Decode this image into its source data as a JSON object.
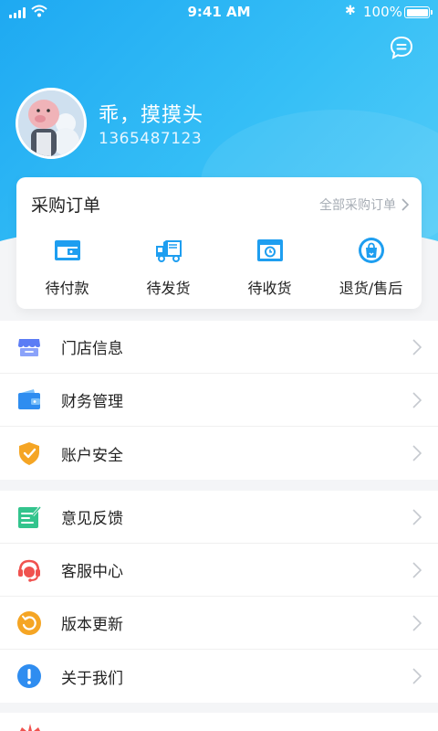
{
  "status_bar": {
    "time": "9:41 AM",
    "battery": "100%",
    "battery_level": 1.0
  },
  "header": {
    "message_icon": "chat-bubble-icon",
    "username": "乖，摸摸头",
    "phone": "1365487123",
    "avatar_icon": "user-avatar"
  },
  "orders": {
    "title": "采购订单",
    "all_link": "全部采购订单",
    "items": [
      {
        "label": "待付款",
        "icon": "wallet-icon"
      },
      {
        "label": "待发货",
        "icon": "truck-icon"
      },
      {
        "label": "待收货",
        "icon": "box-clock-icon"
      },
      {
        "label": "退货/售后",
        "icon": "return-bag-icon"
      }
    ]
  },
  "menu_group_1": [
    {
      "label": "门店信息",
      "icon": "store-icon",
      "color": "#5b7cf5"
    },
    {
      "label": "财务管理",
      "icon": "wallet-icon",
      "color": "#2f8df0"
    },
    {
      "label": "账户安全",
      "icon": "shield-icon",
      "color": "#f5a524"
    }
  ],
  "menu_group_2": [
    {
      "label": "意见反馈",
      "icon": "feedback-icon",
      "color": "#33c48d"
    },
    {
      "label": "客服中心",
      "icon": "headset-icon",
      "color": "#f0524f"
    },
    {
      "label": "版本更新",
      "icon": "refresh-icon",
      "color": "#f5a524"
    },
    {
      "label": "关于我们",
      "icon": "info-icon",
      "color": "#2f8df0"
    }
  ],
  "colors": {
    "brand": "#1ea9f2",
    "text": "#222222",
    "muted": "#a7adb5"
  }
}
